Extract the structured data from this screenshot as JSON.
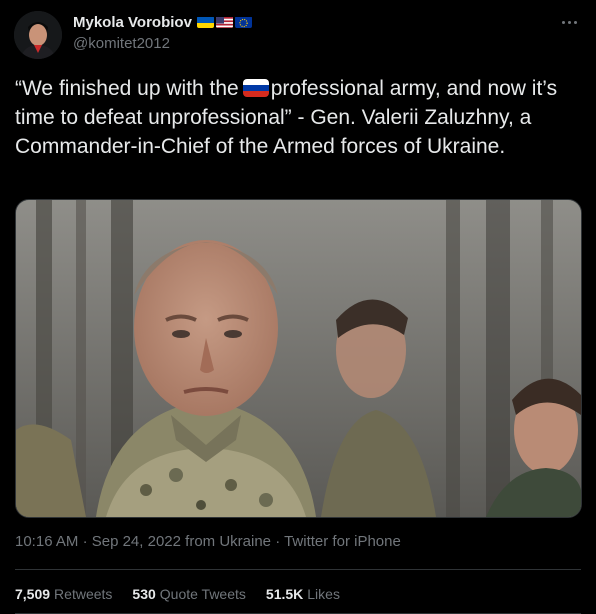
{
  "author": {
    "display_name": "Mykola Vorobiov",
    "handle": "@komitet2012",
    "flags": [
      "ukraine-flag",
      "usa-flag",
      "eu-flag"
    ]
  },
  "tweet": {
    "text_before_flag": "“We finished up with the",
    "inline_flag": "russia-flag",
    "text_after_flag": "professional army, and now it’s time to defeat unprofessional” - Gen. Valerii Zaluzhny, a Commander-in-Chief of the Armed forces of Ukraine."
  },
  "meta": {
    "time": "10:16 AM",
    "date": "Sep 24, 2022",
    "location": "from Ukraine",
    "source": "Twitter for iPhone",
    "separator": "·"
  },
  "stats": {
    "retweets_count": "7,509",
    "retweets_label": "Retweets",
    "quotes_count": "530",
    "quotes_label": "Quote Tweets",
    "likes_count": "51.5K",
    "likes_label": "Likes"
  },
  "colors": {
    "background": "#000000",
    "text": "#e7e9ea",
    "secondary": "#71767b",
    "border": "#2f3336"
  }
}
